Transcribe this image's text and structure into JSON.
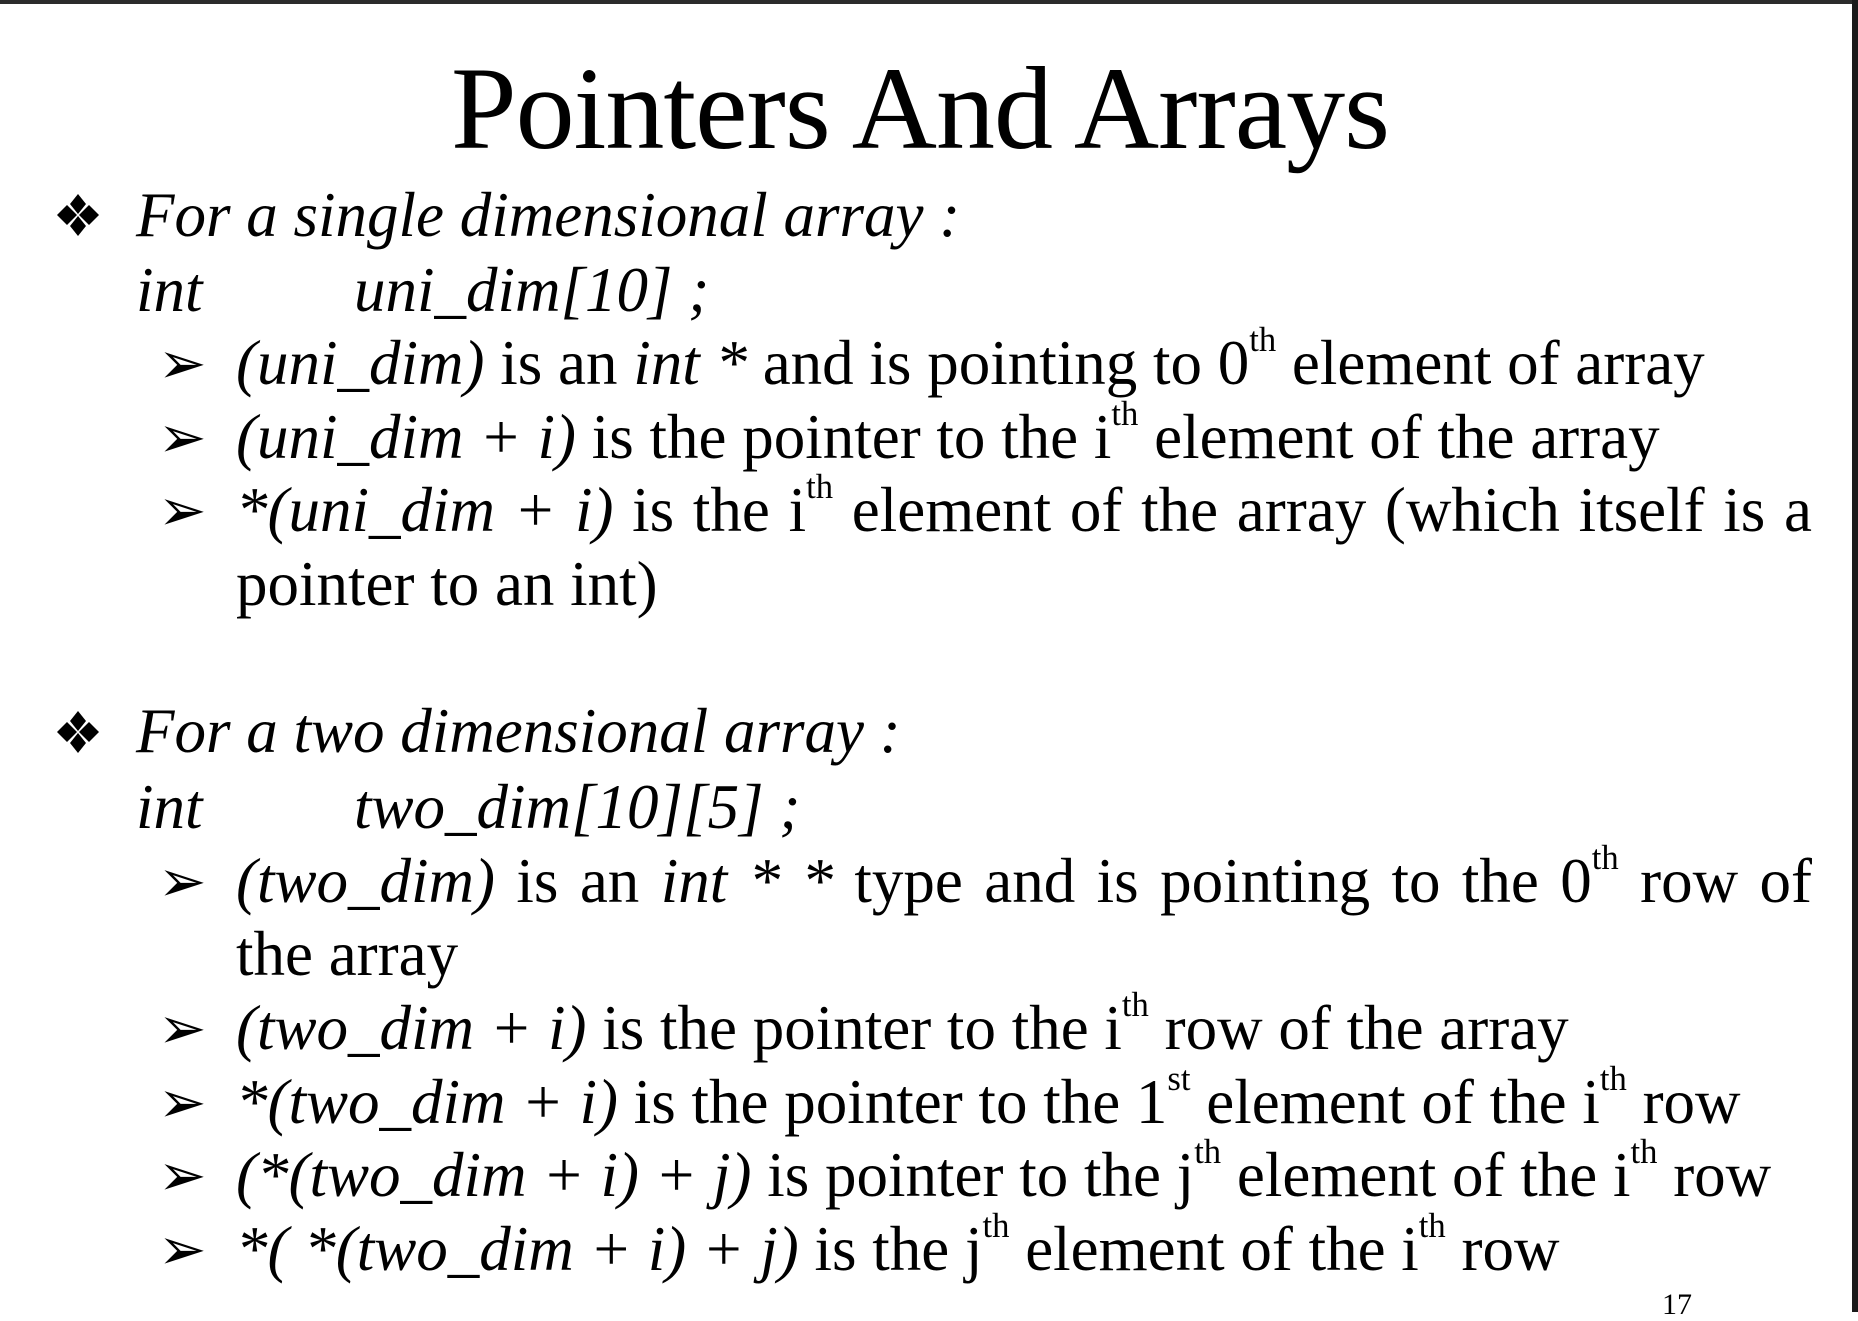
{
  "title": "Pointers And Arrays",
  "sections": [
    {
      "heading": "For a single dimensional array :",
      "decl_type": "int",
      "decl_name": "uni_dim[10] ;",
      "items": [
        {
          "expr": "(uni_dim)",
          "text1": " is an ",
          "type": "int *",
          "text2": "  and is pointing to 0",
          "sup": "th",
          "text3": " element of array"
        },
        {
          "expr": "(uni_dim + i)",
          "text1": " is the pointer to the i",
          "sup": "th",
          "text2": " element of the array"
        },
        {
          "expr": "*(uni_dim + i)",
          "text1": " is the i",
          "sup": "th",
          "text2": " element of the array (which itself is a",
          "cont": "pointer to an int)"
        }
      ]
    },
    {
      "heading": "For a two dimensional array :",
      "decl_type": "int",
      "decl_name": "two_dim[10][5] ;",
      "items": [
        {
          "expr": "(two_dim)",
          "text1": " is an ",
          "type": "int * *",
          "text2": "  type and is pointing to the 0",
          "sup": "th",
          "text3": " row of",
          "cont": "the array"
        },
        {
          "expr": "(two_dim + i)",
          "text1": " is the pointer to the i",
          "sup": "th",
          "text2": " row of the array"
        },
        {
          "expr": "*(two_dim + i)",
          "text1": " is the pointer to the 1",
          "sup": "st",
          "text2": " element of the i",
          "sup2": "th",
          "text3": " row"
        },
        {
          "expr": "(*(two_dim + i) + j)",
          "text1": " is pointer to the j",
          "sup": "th",
          "text2": " element of the i",
          "sup2": "th",
          "text3": " row"
        },
        {
          "expr": "*( *(two_dim + i) + j)",
          "text1": " is the j",
          "sup": "th",
          "text2": " element of the i",
          "sup2": "th",
          "text3": " row"
        }
      ]
    }
  ],
  "bullet_icon": "four-diamond-icon",
  "arrow_icon": "arrowhead-icon",
  "page_number": "17"
}
